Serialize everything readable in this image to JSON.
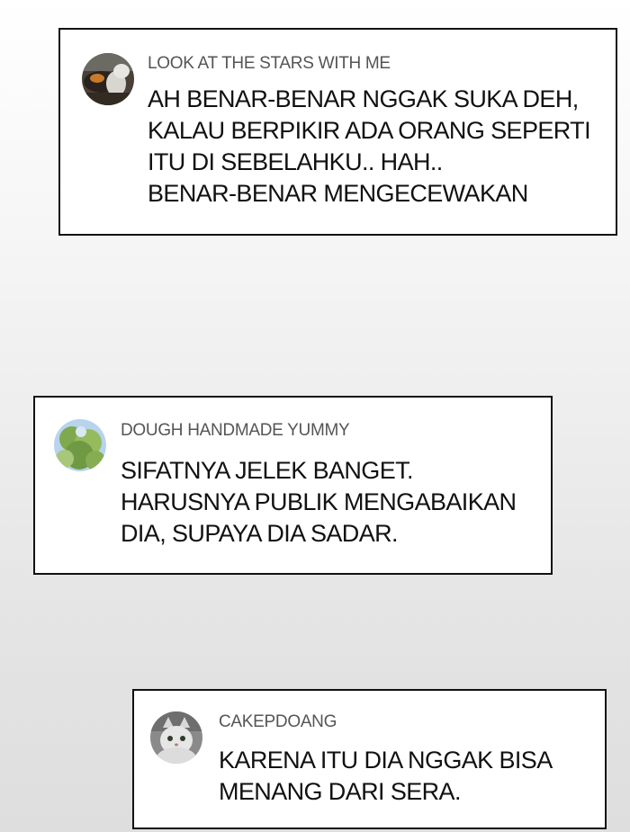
{
  "comments": [
    {
      "avatar": "night-photo-avatar",
      "username": "LOOK AT THE STARS WITH ME",
      "lines": [
        "AH BENAR-BENAR NGGAK SUKA DEH,",
        "KALAU BERPIKIR ADA ORANG SEPERTI",
        "ITU DI SEBELAHKU.. HAH..",
        "BENAR-BENAR MENGECEWAKAN"
      ]
    },
    {
      "avatar": "tree-photo-avatar",
      "username": "DOUGH HANDMADE YUMMY",
      "lines": [
        "SIFATNYA JELEK BANGET.",
        "HARUSNYA PUBLIK MENGABAIKAN",
        "DIA, SUPAYA DIA SADAR."
      ]
    },
    {
      "avatar": "cat-photo-avatar",
      "username": "CAKEPDOANG",
      "lines": [
        "KARENA ITU DIA NGGAK BISA",
        "MENANG DARI SERA."
      ]
    }
  ]
}
